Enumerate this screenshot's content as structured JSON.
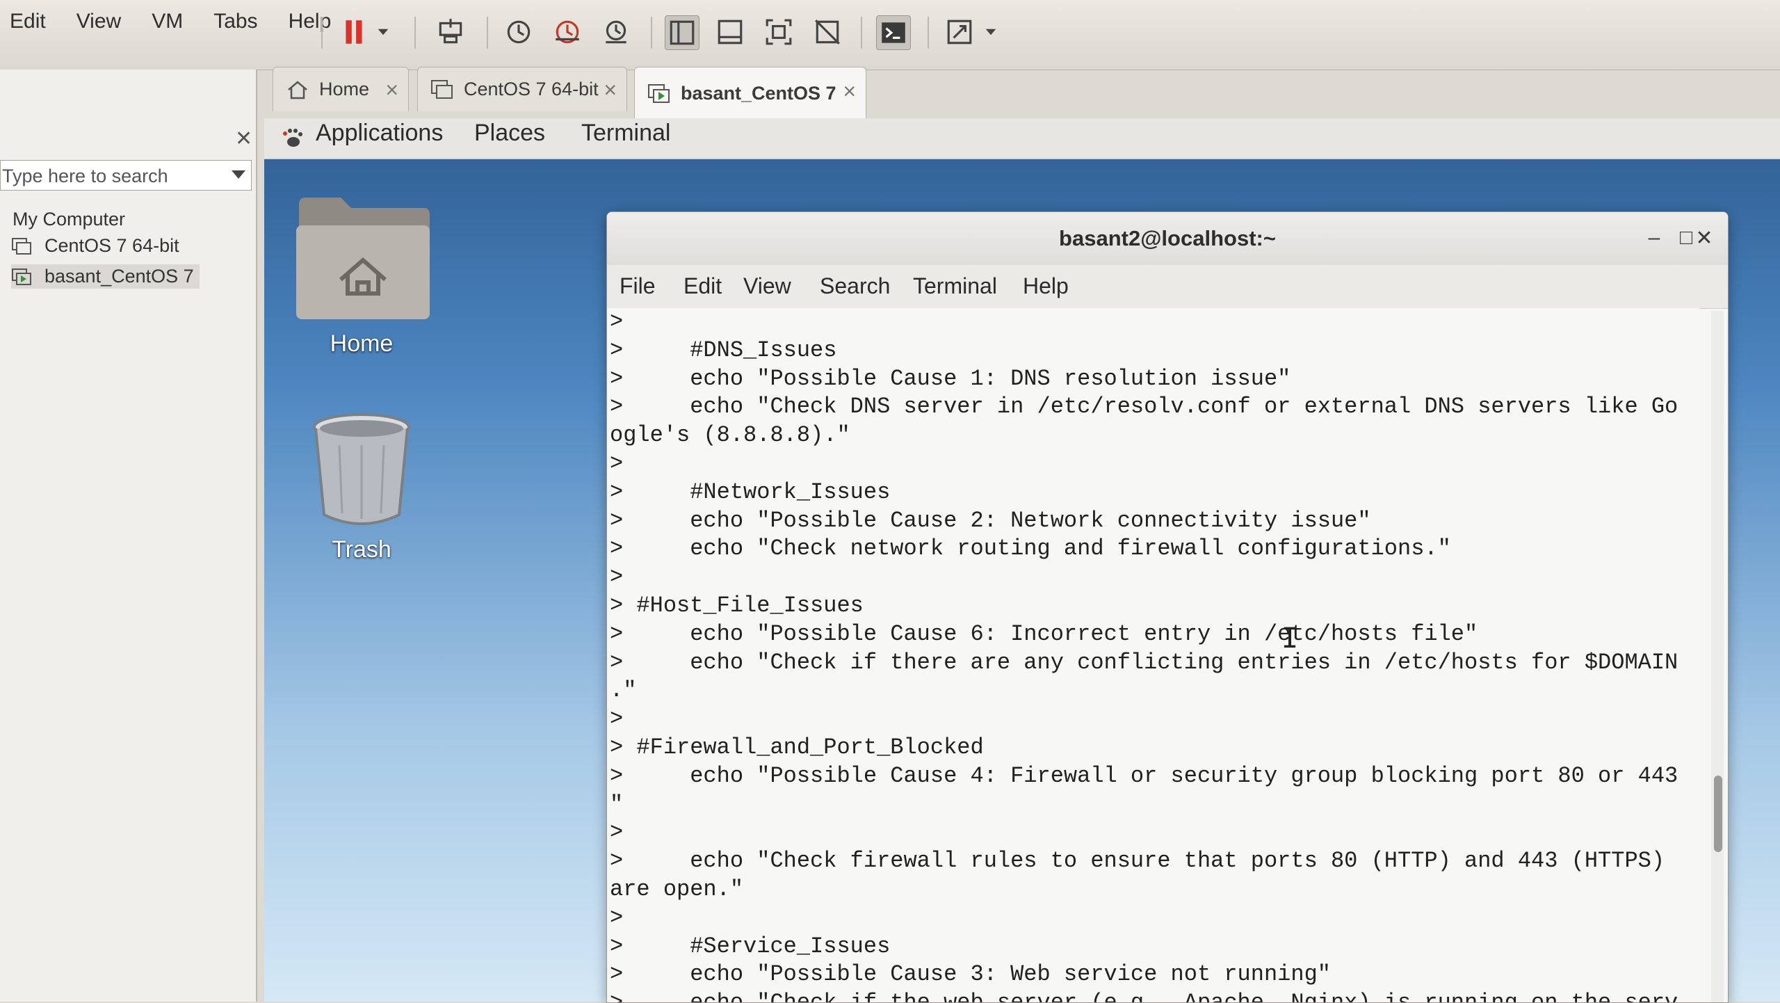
{
  "host_menu": [
    "Edit",
    "View",
    "VM",
    "Tabs",
    "Help"
  ],
  "toolbar_icons": [
    "pause-icon",
    "dropdown-icon",
    "send-ctrl-alt-del-icon",
    "snapshot-icon",
    "revert-snapshot-icon",
    "manage-snapshots-icon",
    "library-view-icon",
    "thumbnail-bar-icon",
    "full-screen-icon",
    "unity-icon",
    "console-view-icon",
    "stretch-guest-icon",
    "dropdown-icon"
  ],
  "library": {
    "search_placeholder": "Type here to search",
    "root": "My Computer",
    "items": [
      "CentOS 7 64-bit",
      "basant_CentOS 7"
    ],
    "selected_index": 1
  },
  "tabs": [
    {
      "label": "Home",
      "icon": "home-icon"
    },
    {
      "label": "CentOS 7 64-bit",
      "icon": "vm-icon"
    },
    {
      "label": "basant_CentOS 7",
      "icon": "vm-running-icon",
      "active": true
    }
  ],
  "guest": {
    "topbar": {
      "applications": "Applications",
      "places": "Places",
      "terminal": "Terminal"
    },
    "desktop_icons": [
      {
        "label": "Home",
        "icon": "home-folder-icon"
      },
      {
        "label": "Trash",
        "icon": "trash-icon"
      }
    ]
  },
  "terminal": {
    "title": "basant2@localhost:~",
    "window_buttons": {
      "minimize": "–",
      "maximize": "□",
      "close": "✕"
    },
    "menu": [
      "File",
      "Edit",
      "View",
      "Search",
      "Terminal",
      "Help"
    ],
    "lines": [
      ">",
      ">     #DNS_Issues",
      ">     echo \"Possible Cause 1: DNS resolution issue\"",
      ">     echo \"Check DNS server in /etc/resolv.conf or external DNS servers like Go",
      "ogle's (8.8.8.8).\"",
      ">",
      ">     #Network_Issues",
      ">     echo \"Possible Cause 2: Network connectivity issue\"",
      ">     echo \"Check network routing and firewall configurations.\"",
      ">",
      "> #Host_File_Issues",
      ">     echo \"Possible Cause 6: Incorrect entry in /etc/hosts file\"",
      ">     echo \"Check if there are any conflicting entries in /etc/hosts for $DOMAIN",
      ".\"",
      ">",
      "> #Firewall_and_Port_Blocked",
      ">     echo \"Possible Cause 4: Firewall or security group blocking port 80 or 443",
      "\"",
      ">",
      ">     echo \"Check firewall rules to ensure that ports 80 (HTTP) and 443 (HTTPS)",
      "are open.\"",
      ">",
      ">     #Service_Issues",
      ">     echo \"Possible Cause 3: Web service not running\"",
      ">     echo \"Check if the web server (e.g., Apache, Nginx) is running on the serv"
    ]
  },
  "colors": {
    "pause": "#d9322b",
    "guest_bg_top": "#2e5d92",
    "terminal_bg": "#f7f7f6"
  }
}
